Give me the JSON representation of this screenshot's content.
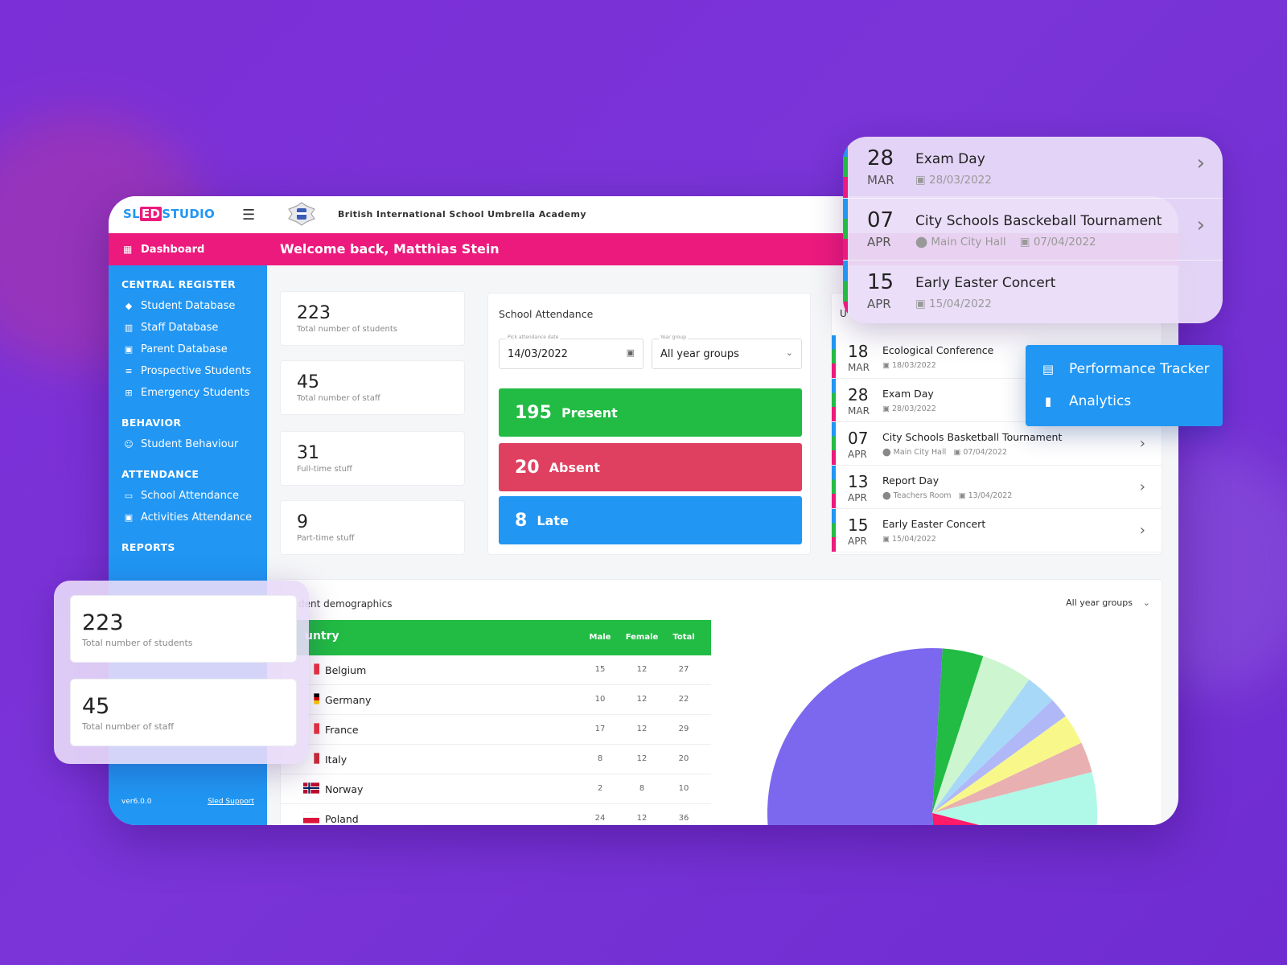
{
  "brand": {
    "part1": "SL",
    "part2": "ED",
    "part3": "STUDIO"
  },
  "school_name": "British International School Umbrella Academy",
  "sidebar": {
    "dashboard": "Dashboard",
    "sections": [
      {
        "title": "CENTRAL REGISTER",
        "items": [
          "Student Database",
          "Staff Database",
          "Parent Database",
          "Prospective Students",
          "Emergency Students"
        ]
      },
      {
        "title": "BEHAVIOR",
        "items": [
          "Student Behaviour"
        ]
      },
      {
        "title": "ATTENDANCE",
        "items": [
          "School Attendance",
          "Activities Attendance"
        ]
      },
      {
        "title": "REPORTS",
        "items": []
      }
    ],
    "version": "ver6.0.0",
    "support": "Sled Support"
  },
  "welcome": "Welcome back, Matthias Stein",
  "stats": [
    {
      "value": "223",
      "label": "Total number of students"
    },
    {
      "value": "45",
      "label": "Total number of staff"
    },
    {
      "value": "31",
      "label": "Full-time stuff"
    },
    {
      "value": "9",
      "label": "Part-time stuff"
    }
  ],
  "attendance": {
    "title": "School Attendance",
    "date_label": "Pick attendance date",
    "date_value": "14/03/2022",
    "group_label": "Year group",
    "group_value": "All year groups",
    "present": {
      "value": "195",
      "label": "Present"
    },
    "absent": {
      "value": "20",
      "label": "Absent"
    },
    "late": {
      "value": "8",
      "label": "Late"
    },
    "colors": {
      "present": "#22bb44",
      "absent": "#e04060",
      "late": "#2196f3"
    }
  },
  "events": [
    {
      "day": "18",
      "month": "MAR",
      "title": "Ecological Conference",
      "location": "",
      "date": "18/03/2022"
    },
    {
      "day": "28",
      "month": "MAR",
      "title": "Exam Day",
      "location": "",
      "date": "28/03/2022"
    },
    {
      "day": "07",
      "month": "APR",
      "title": "City Schools Basketball Tournament",
      "location": "Main City Hall",
      "date": "07/04/2022"
    },
    {
      "day": "13",
      "month": "APR",
      "title": "Report Day",
      "location": "Teachers Room",
      "date": "13/04/2022"
    },
    {
      "day": "15",
      "month": "APR",
      "title": "Early Easter Concert",
      "location": "",
      "date": "15/04/2022"
    }
  ],
  "events_header_fragment": "U",
  "float_events": [
    {
      "day": "28",
      "month": "MAR",
      "title": "Exam Day",
      "location": "",
      "date": "28/03/2022"
    },
    {
      "day": "07",
      "month": "APR",
      "title": "City Schools Basckeball Tournament",
      "location": "Main City Hall",
      "date": "07/04/2022"
    },
    {
      "day": "15",
      "month": "APR",
      "title": "Early Easter Concert",
      "location": "",
      "date": "15/04/2022"
    }
  ],
  "float_menu": [
    "Performance Tracker",
    "Analytics"
  ],
  "demographics": {
    "title": "dent demographics",
    "group_select": "All year groups",
    "columns": [
      "untry",
      "Male",
      "Female",
      "Total"
    ],
    "rows": [
      {
        "country": "Belgium",
        "male": "15",
        "female": "12",
        "total": "27"
      },
      {
        "country": "Germany",
        "male": "10",
        "female": "12",
        "total": "22"
      },
      {
        "country": "France",
        "male": "17",
        "female": "12",
        "total": "29"
      },
      {
        "country": "Italy",
        "male": "8",
        "female": "12",
        "total": "20"
      },
      {
        "country": "Norway",
        "male": "2",
        "female": "8",
        "total": "10"
      },
      {
        "country": "Poland",
        "male": "24",
        "female": "12",
        "total": "36"
      }
    ]
  },
  "chart_data": {
    "type": "pie",
    "title": "",
    "slices": [
      {
        "value": 51,
        "color": "#7b68ee"
      },
      {
        "value": 4,
        "color": "#22bb44"
      },
      {
        "value": 5,
        "color": "#cdf5cf"
      },
      {
        "value": 3,
        "color": "#a8d8f8"
      },
      {
        "value": 2,
        "color": "#b0b8f8"
      },
      {
        "value": 3,
        "color": "#f8f88a"
      },
      {
        "value": 3,
        "color": "#e8b0b0"
      },
      {
        "value": 8,
        "color": "#b0f8e8"
      },
      {
        "value": 20,
        "color": "#ff1a6a"
      },
      {
        "value": 1,
        "color": "#2196f3"
      }
    ]
  },
  "float_stats": [
    {
      "value": "223",
      "label": "Total number of students"
    },
    {
      "value": "45",
      "label": "Total number of staff"
    }
  ]
}
